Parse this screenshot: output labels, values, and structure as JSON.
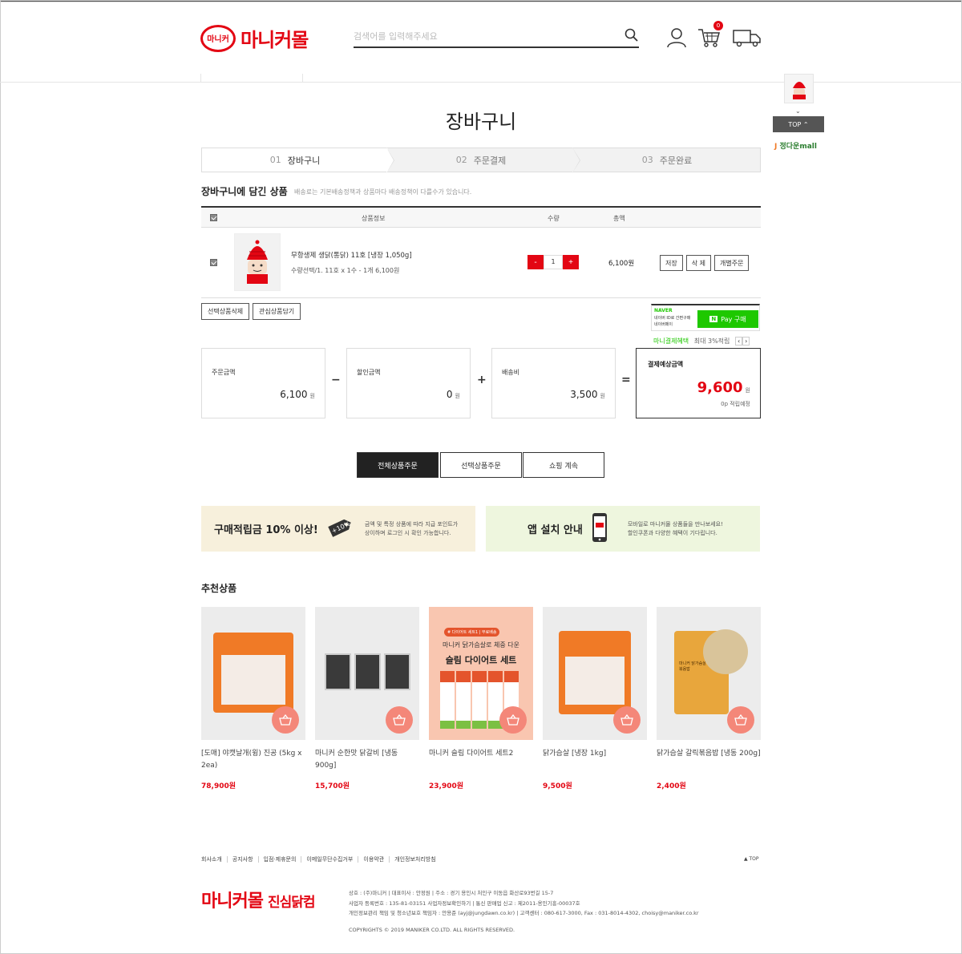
{
  "header": {
    "logo_badge": "마니커",
    "logo_text": "마니커몰",
    "search_placeholder": "검색어를 입력해주세요",
    "cart_count": "0"
  },
  "quick": {
    "top_label": "TOP ⌃",
    "down_arrow": "⌄",
    "jmall": "정다운mall"
  },
  "page_title": "장바구니",
  "steps": [
    {
      "num": "01",
      "label": "장바구니"
    },
    {
      "num": "02",
      "label": "주문결제"
    },
    {
      "num": "03",
      "label": "주문완료"
    }
  ],
  "cart": {
    "title": "장바구니에 담긴 상품",
    "note": "배송료는 기본배송정책과 상품마다 배송정책이 다를수가 있습니다.",
    "headers": {
      "info": "상품정보",
      "qty": "수량",
      "total": "총액"
    },
    "item": {
      "name": "무항생제 생닭(통닭) 11호 [냉장 1,050g]",
      "option": "수량선택/1. 11호 x 1수 - 1개 6,100원",
      "qty_minus": "-",
      "qty": "1",
      "qty_plus": "+",
      "total": "6,100원",
      "btn_save": "저장",
      "btn_delete": "삭 제",
      "btn_order": "개별주문"
    },
    "btn_delete_selected": "선택상품삭제",
    "btn_wish": "관심상품담기"
  },
  "naver": {
    "brand": "NAVER",
    "desc1": "네이버 ID로 간편구매",
    "desc2": "네이버페이",
    "pay_n": "N",
    "pay_label": "Pay 구매",
    "benefit_label": "마니결제혜택",
    "benefit_text": "최대 3%적립",
    "prev": "‹",
    "next": "›"
  },
  "totals": {
    "order_label": "주문금액",
    "order_amount": "6,100",
    "won": "원",
    "discount_label": "할인금액",
    "discount_amount": "0",
    "shipping_label": "배송비",
    "shipping_amount": "3,500",
    "minus": "−",
    "plus": "+",
    "equals": "=",
    "final_label": "결제예상금액",
    "final_amount": "9,600",
    "points": "0p 적립예정"
  },
  "actions": {
    "all": "전체상품주문",
    "selected": "선택상품주문",
    "continue": "쇼핑 계속"
  },
  "banners": {
    "points_big": "구매적립금 10% 이상!",
    "points_tag": "+10%",
    "points_desc1": "금액 및 특정 상품에 따라 지급 포인트가",
    "points_desc2": "상이하며 로그인 시 확인 가능합니다.",
    "app_big": "앱 설치 안내",
    "app_desc1": "모바일로 마니커몰 상품들을 만나보세요!",
    "app_desc2": "할인쿠폰과 다양한 혜택이 기다립니다.",
    "colors": {
      "points_bg": "#f7f0dc",
      "app_bg": "#eef6de"
    }
  },
  "reco": {
    "title": "추천상품",
    "items": [
      {
        "name": "[도매] 야캣날개(윙) 진공 (5kg x 2ea)",
        "price": "78,900원"
      },
      {
        "name": "마니커 순한맛 닭갈비 [냉동 900g]",
        "price": "15,700원"
      },
      {
        "name": "마니커 슬림 다이어트 세트2",
        "price": "23,900원",
        "promo_tag": "# 다이어트 세트1 | 무료배송",
        "promo_line1": "마니커 닭가슴살로 체중 다운",
        "promo_line2": "슬림 다이어트 세트"
      },
      {
        "name": "닭가슴살 [냉장 1kg]",
        "price": "9,500원"
      },
      {
        "name": "닭가슴살 갈릭볶음밥 [냉동 200g]",
        "price": "2,400원",
        "pkg_text": "마니커 닭가슴살 갈릭 볶음밥"
      }
    ]
  },
  "footer": {
    "links": [
      "회사소개",
      "공지사항",
      "입점·제휴문의",
      "이메일무단수집거부",
      "이용약관",
      "개인정보처리방침"
    ],
    "top": "▲ TOP",
    "logo": "마니커몰",
    "logo_sub": "진심닭컴",
    "info1": "상호 : (주)마니커  |  대표이사 : 안정원  |  주소 : 경기 용인시 처인구 이동읍 화산로93번길 15-7",
    "info2": "사업자 등록번호 : 135-81-03151 사업자정보확인하기  |  통신 판매업 신고 : 제2011-용인기흥-00037호",
    "info3": "개인정보관리 책임 및 청소년보호 책임자 : 안용준 (ayj@jungdawn.co.kr)  |  고객센터 : 080-617-3000, Fax : 031-8014-4302, choisy@maniker.co.kr",
    "copyright": "COPYRIGHTS © 2019 MANIKER CO.LTD. ALL RIGHTS RESERVED."
  }
}
